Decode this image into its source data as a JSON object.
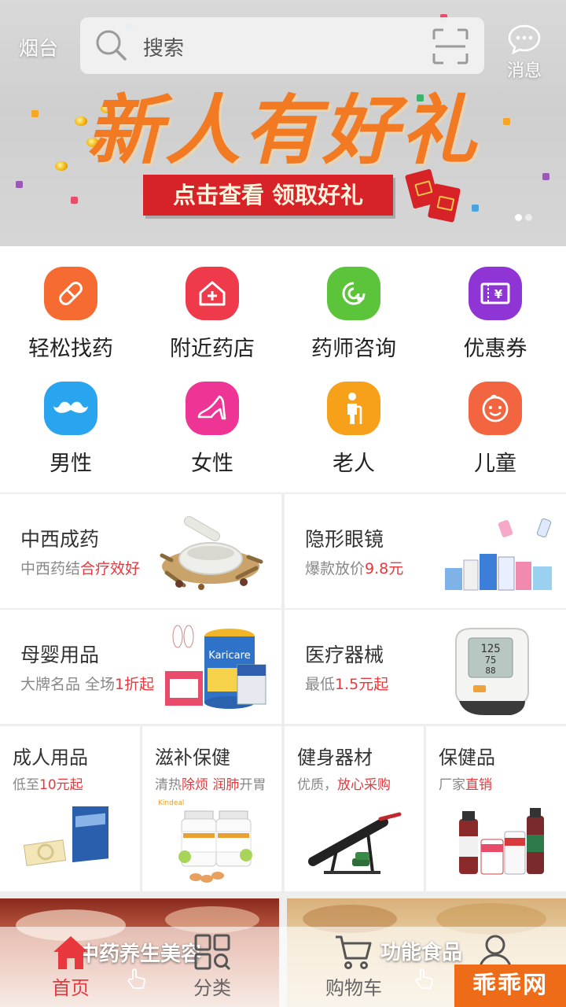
{
  "header": {
    "city": "烟台",
    "search_placeholder": "搜索",
    "message_label": "消息"
  },
  "banner": {
    "title": "新人有好礼",
    "subtitle": "点击查看 领取好礼",
    "page_dots": 2,
    "active_dot": 1
  },
  "icon_nav": [
    {
      "label": "轻松找药",
      "icon": "pill-icon",
      "color": "#f56b32"
    },
    {
      "label": "附近药店",
      "icon": "store-icon",
      "color": "#ee3a4a"
    },
    {
      "label": "药师咨询",
      "icon": "consult-icon",
      "color": "#5cc43a"
    },
    {
      "label": "优惠券",
      "icon": "coupon-icon",
      "color": "#8f35d6"
    },
    {
      "label": "男性",
      "icon": "mustache-icon",
      "color": "#28a5ee"
    },
    {
      "label": "女性",
      "icon": "high-heel-icon",
      "color": "#ee3494"
    },
    {
      "label": "老人",
      "icon": "elder-icon",
      "color": "#f7a11b"
    },
    {
      "label": "儿童",
      "icon": "child-face-icon",
      "color": "#f26540"
    }
  ],
  "categories": {
    "large": [
      {
        "title": "中西成药",
        "sub_prefix": "中西药结",
        "sub_highlight": "合疗效好",
        "sub_suffix": ""
      },
      {
        "title": "隐形眼镜",
        "sub_prefix": "爆款放价",
        "sub_highlight": "9.8元",
        "sub_suffix": ""
      },
      {
        "title": "母婴用品",
        "sub_prefix": "大牌名品 全场",
        "sub_highlight": "1折起",
        "sub_suffix": ""
      },
      {
        "title": "医疗器械",
        "sub_prefix": "最低",
        "sub_highlight": "1.5元起",
        "sub_suffix": ""
      }
    ],
    "small": [
      {
        "title": "成人用品",
        "sub_prefix": "低至",
        "sub_highlight": "10元起",
        "sub_suffix": ""
      },
      {
        "title": "滋补保健",
        "sub_prefix": "清热",
        "sub_highlight": "除烦 润肺",
        "sub_suffix": "开胃"
      },
      {
        "title": "健身器材",
        "sub_prefix": "优质，",
        "sub_highlight": "放心采购",
        "sub_suffix": ""
      },
      {
        "title": "保健品",
        "sub_prefix": "厂家",
        "sub_highlight": "直销",
        "sub_suffix": ""
      }
    ]
  },
  "promos": [
    {
      "label": "中药养生美容"
    },
    {
      "label": "功能食品"
    }
  ],
  "tabbar": [
    {
      "label": "首页",
      "icon": "home-icon",
      "active": true
    },
    {
      "label": "分类",
      "icon": "category-icon",
      "active": false
    },
    {
      "label": "购物车",
      "icon": "cart-icon",
      "active": false
    },
    {
      "label": "",
      "icon": "user-icon",
      "active": false
    }
  ],
  "watermark": "乖乖网",
  "colors": {
    "accent": "#e8383d",
    "divider": "#eeeeee"
  }
}
